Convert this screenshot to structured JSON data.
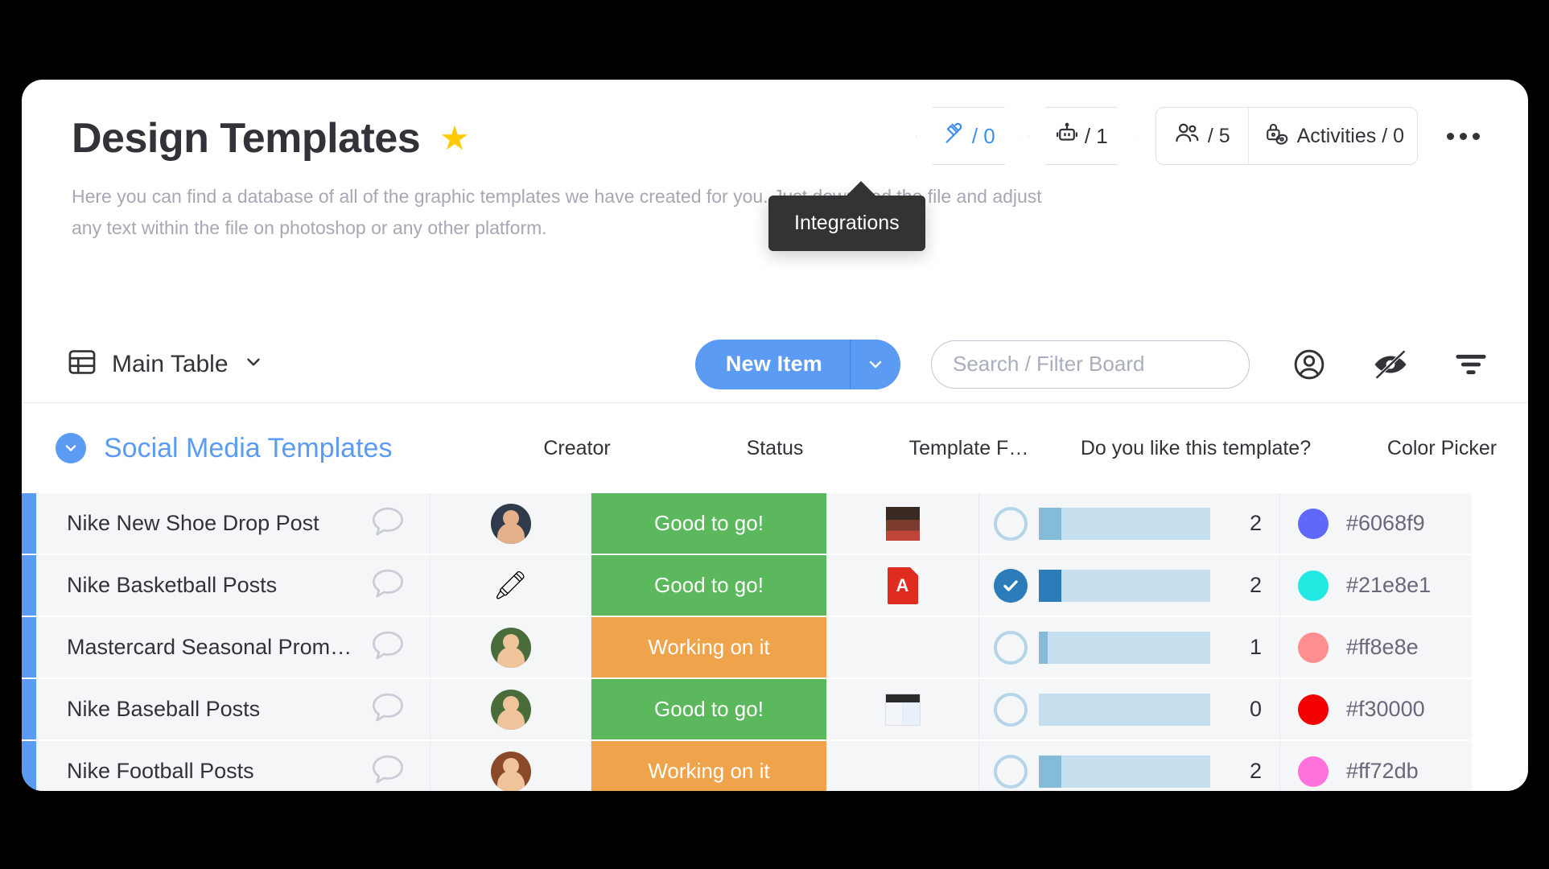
{
  "header": {
    "title": "Design Templates",
    "star_icon": "star-icon",
    "description": "Here you can find a database of all of the graphic templates we have created for you. Just download the file and adjust any text within the file on photoshop or any other platform.",
    "integrations": {
      "icon": "plug-icon",
      "count": "/ 0",
      "color": "#3d8fef"
    },
    "automations": {
      "icon": "robot-icon",
      "count": "/ 1"
    },
    "members": {
      "icon": "people-icon",
      "count": "/ 5"
    },
    "activities": {
      "icon": "lock-key-icon",
      "label": "Activities / 0"
    },
    "more_menu": "more-options-icon"
  },
  "tooltip": {
    "text": "Integrations"
  },
  "toolbar": {
    "view_icon": "table-icon",
    "view_name": "Main Table",
    "view_caret": "chevron-down-icon",
    "new_item_label": "New Item",
    "new_item_caret": "chevron-down-icon",
    "search_placeholder": "Search / Filter Board",
    "search_value": "",
    "person_icon": "person-circle-icon",
    "hide_icon": "eye-slash-icon",
    "filter_icon": "filter-icon"
  },
  "table": {
    "group_name": "Social Media Templates",
    "group_caret": "chevron-down-icon",
    "columns": [
      "Creator",
      "Status",
      "Template F…",
      "Do you like this template?",
      "Color Picker"
    ],
    "rows": [
      {
        "name": "Nike New Shoe Drop Post",
        "comment_icon": "comment-bubble-icon",
        "creator_avatar": "avatar-man-dark",
        "status": "Good to go!",
        "status_color": "#5cb85c",
        "file": "image-thumbnail",
        "liked": false,
        "progress": 13,
        "progress_color": "#82bcd9",
        "rating": "2",
        "color_hex": "#6068f9"
      },
      {
        "name": "Nike Basketball Posts",
        "comment_icon": "comment-bubble-icon",
        "creator_avatar": "pencil-emoji",
        "status": "Good to go!",
        "status_color": "#5cb85c",
        "file": "pdf-file",
        "liked": true,
        "progress": 13,
        "progress_color": "#2b7cb8",
        "rating": "2",
        "color_hex": "#21e8e1"
      },
      {
        "name": "Mastercard Seasonal Prom…",
        "comment_icon": "comment-bubble-icon",
        "creator_avatar": "avatar-woman-green",
        "status": "Working on it",
        "status_color": "#efa martín",
        "file": "none",
        "liked": false,
        "progress": 5,
        "progress_color": "#82bcd9",
        "rating": "1",
        "color_hex": "#ff8e8e"
      },
      {
        "name": "Nike Baseball Posts",
        "comment_icon": "comment-bubble-icon",
        "creator_avatar": "avatar-woman-green",
        "status": "Good to go!",
        "status_color": "#5cb85c",
        "file": "document-thumbnail",
        "liked": false,
        "progress": 0,
        "progress_color": "#82bcd9",
        "rating": "0",
        "color_hex": "#f30000"
      },
      {
        "name": "Nike Football Posts",
        "comment_icon": "comment-bubble-icon",
        "creator_avatar": "avatar-woman-brown",
        "status": "Working on it",
        "status_color": "#efa44b",
        "file": "none",
        "liked": false,
        "progress": 13,
        "progress_color": "#82bcd9",
        "rating": "2",
        "color_hex": "#ff72db"
      }
    ]
  },
  "palette": {
    "accent_blue": "#5b9bf3",
    "status_green": "#5cb85c",
    "status_orange": "#efa44b",
    "row_bg": "#f5f6f8",
    "text_dark": "#323338",
    "text_muted": "#a6a8b4"
  }
}
